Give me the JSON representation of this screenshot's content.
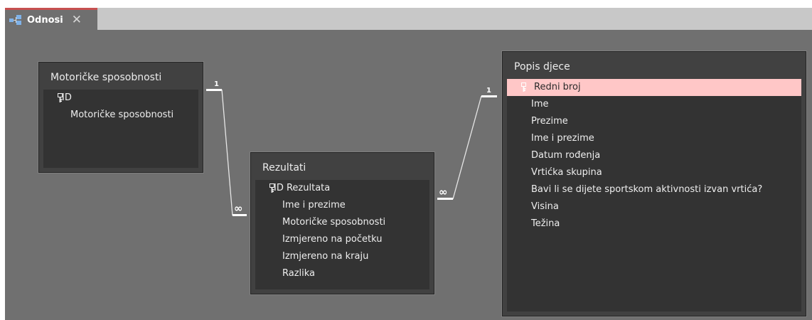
{
  "tab": {
    "title": "Odnosi",
    "icon": "relationships-icon",
    "close_label": "✕"
  },
  "colors": {
    "canvas": "#707070",
    "table_bg": "#414141",
    "field_list_bg": "#333333",
    "selected_row": "#ffc7c7",
    "tab_accent": "#c75050"
  },
  "tables": {
    "motoricke": {
      "title": "Motoričke sposobnosti",
      "fields": [
        "ID",
        "Motoričke sposobnosti"
      ],
      "primary_key": "ID"
    },
    "rezultati": {
      "title": "Rezultati",
      "fields": [
        "ID Rezultata",
        "Ime i prezime",
        "Motoričke sposobnosti",
        "Izmjereno na početku",
        "Izmjereno na kraju",
        "Razlika"
      ],
      "primary_key": "ID Rezultata"
    },
    "popis": {
      "title": "Popis djece",
      "fields": [
        "Redni broj",
        "Ime",
        "Prezime",
        "Ime i prezime",
        "Datum rođenja",
        "Vrtićka skupina",
        "Bavi li se dijete sportskom aktivnosti izvan vrtića?",
        "Visina",
        "Težina"
      ],
      "primary_key": "Redni broj",
      "selected_field": "Redni broj"
    }
  },
  "relationships": [
    {
      "from": "Motoričke sposobnosti.ID",
      "to": "Rezultati.Motoričke sposobnosti",
      "one_label": "1",
      "many_label": "∞"
    },
    {
      "from": "Popis djece.Redni broj",
      "to": "Rezultati.Ime i prezime",
      "one_label": "1",
      "many_label": "∞"
    }
  ]
}
